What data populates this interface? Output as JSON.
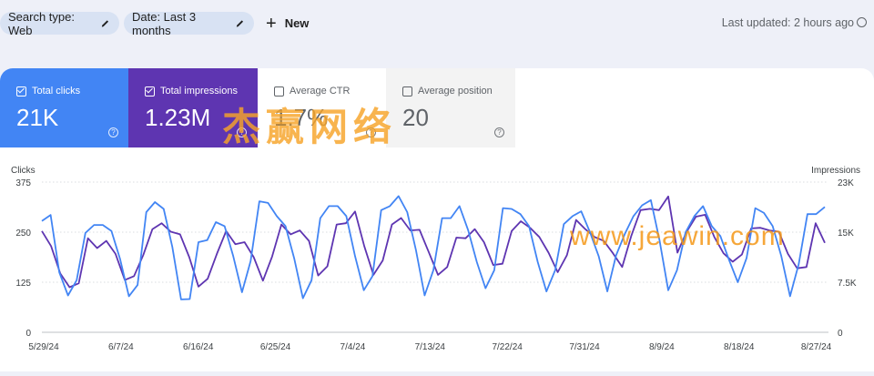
{
  "filters": {
    "search_type": "Search type: Web",
    "date": "Date: Last 3 months",
    "new": "New"
  },
  "last_updated": "Last updated: 2 hours ago",
  "metrics": [
    {
      "label": "Total clicks",
      "value": "21K",
      "checked": true,
      "color": "#4285f4"
    },
    {
      "label": "Total impressions",
      "value": "1.23M",
      "checked": true,
      "color": "#5e35b1"
    },
    {
      "label": "Average CTR",
      "value": "1.7%",
      "checked": false
    },
    {
      "label": "Average position",
      "value": "20",
      "checked": false
    }
  ],
  "watermark": {
    "cn": "杰赢网络",
    "url": "www.jeawin.com"
  },
  "chart_data": {
    "type": "line",
    "left_axis": {
      "label": "Clicks",
      "ticks": [
        "375",
        "250",
        "125",
        "0"
      ],
      "range": [
        0,
        375
      ]
    },
    "right_axis": {
      "label": "Impressions",
      "ticks": [
        "23K",
        "15K",
        "7.5K",
        "0"
      ],
      "range": [
        0,
        23000
      ]
    },
    "x_tick_labels": [
      "5/29/24",
      "6/7/24",
      "6/16/24",
      "6/25/24",
      "7/4/24",
      "7/13/24",
      "7/22/24",
      "7/31/24",
      "8/9/24",
      "8/18/24",
      "8/27/24"
    ],
    "x_start": "5/29/24",
    "x_end": "8/28/24",
    "series": [
      {
        "name": "Clicks",
        "axis": "left",
        "color": "#4285f4",
        "values": [
          278,
          293,
          150,
          92,
          130,
          248,
          268,
          268,
          253,
          182,
          90,
          118,
          300,
          325,
          308,
          213,
          82,
          83,
          225,
          230,
          275,
          265,
          190,
          100,
          178,
          327,
          323,
          290,
          265,
          185,
          85,
          130,
          285,
          315,
          315,
          290,
          190,
          105,
          140,
          305,
          315,
          340,
          300,
          205,
          92,
          155,
          285,
          285,
          315,
          255,
          175,
          110,
          155,
          310,
          308,
          295,
          265,
          175,
          102,
          155,
          270,
          290,
          302,
          250,
          190,
          102,
          192,
          245,
          290,
          317,
          330,
          230,
          105,
          155,
          250,
          290,
          315,
          265,
          240,
          180,
          125,
          185,
          310,
          298,
          265,
          190,
          90,
          170,
          295,
          295,
          313
        ]
      },
      {
        "name": "Impressions",
        "axis": "right",
        "values": [
          15500,
          13200,
          9000,
          6900,
          7500,
          14400,
          12900,
          14000,
          12000,
          8000,
          8600,
          11800,
          15800,
          16700,
          15400,
          15000,
          11500,
          7000,
          8200,
          12000,
          15500,
          13500,
          13800,
          11500,
          7900,
          11600,
          16500,
          15000,
          15600,
          14000,
          8700,
          10100,
          16500,
          16700,
          18500,
          13200,
          8800,
          11000,
          16500,
          17500,
          15600,
          15700,
          12300,
          8800,
          10000,
          14500,
          14400,
          15800,
          13800,
          10300,
          10500,
          15500,
          17000,
          16000,
          14600,
          12200,
          9200,
          11800,
          17200,
          15800,
          14600,
          14000,
          12100,
          10000,
          14800,
          18700,
          18900,
          18700,
          20800,
          12200,
          15400,
          17700,
          18000,
          14600,
          12100,
          10800,
          11900,
          15900,
          16000,
          15600,
          15400,
          12000,
          9800,
          10000,
          16700,
          13700
        ]
      }
    ],
    "grid": "horizontal, dotted"
  }
}
